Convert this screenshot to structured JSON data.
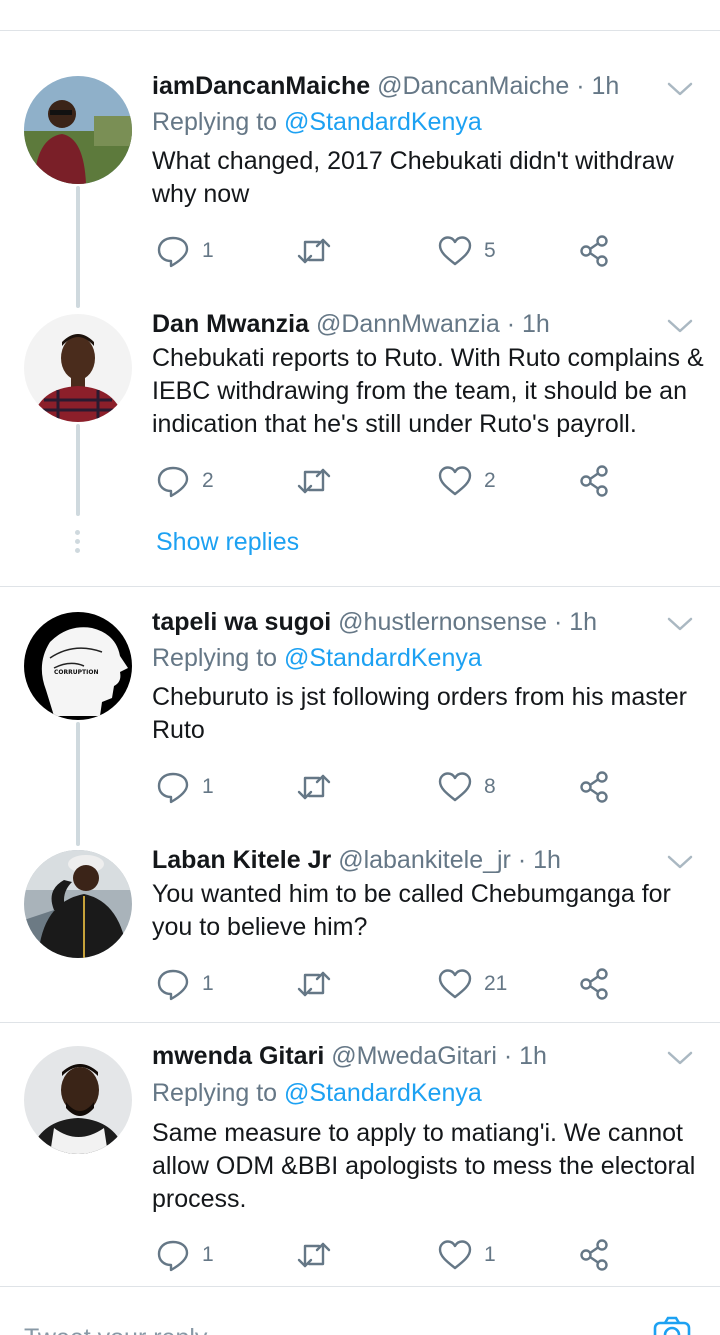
{
  "tweets": [
    {
      "name": "iamDancanMaiche",
      "handle": "@DancanMaiche",
      "time": "1h",
      "replying_label": "Replying to",
      "replying_to": "@StandardKenya",
      "text": "What changed, 2017 Chebukati didn't withdraw why now",
      "replies": "1",
      "likes": "5"
    },
    {
      "name": "Dan Mwanzia",
      "handle": "@DannMwanzia",
      "time": "1h",
      "text": "Chebukati reports to Ruto.  With Ruto complains & IEBC withdrawing from the team, it should be an indication that he's still under Ruto's payroll.",
      "replies": "2",
      "likes": "2"
    },
    {
      "name": "tapeli wa sugoi",
      "handle": "@hustlernonsense",
      "time": "1h",
      "replying_label": "Replying to",
      "replying_to": "@StandardKenya",
      "text": "Cheburuto is jst following orders from his master Ruto",
      "replies": "1",
      "likes": "8"
    },
    {
      "name": "Laban Kitele Jr",
      "handle": "@labankitele_jr",
      "time": "1h",
      "text": "You wanted him to be called Chebumganga for you to believe him?",
      "replies": "1",
      "likes": "21"
    },
    {
      "name": "mwenda Gitari",
      "handle": "@MwedaGitari",
      "time": "1h",
      "replying_label": "Replying to",
      "replying_to": "@StandardKenya",
      "text": "Same measure to apply to matiang'i. We cannot allow ODM &BBI apologists to mess the electoral process.",
      "replies": "1",
      "likes": "1"
    }
  ],
  "separator": "·",
  "show_replies": "Show replies",
  "avatar_logo_text": "CORRUPTION",
  "compose_placeholder": "Tweet your reply",
  "colors": {
    "accent": "#1da1f2",
    "secondary_text": "#657786",
    "divider": "#dfe3e7",
    "thread_line": "#cfd9de"
  }
}
